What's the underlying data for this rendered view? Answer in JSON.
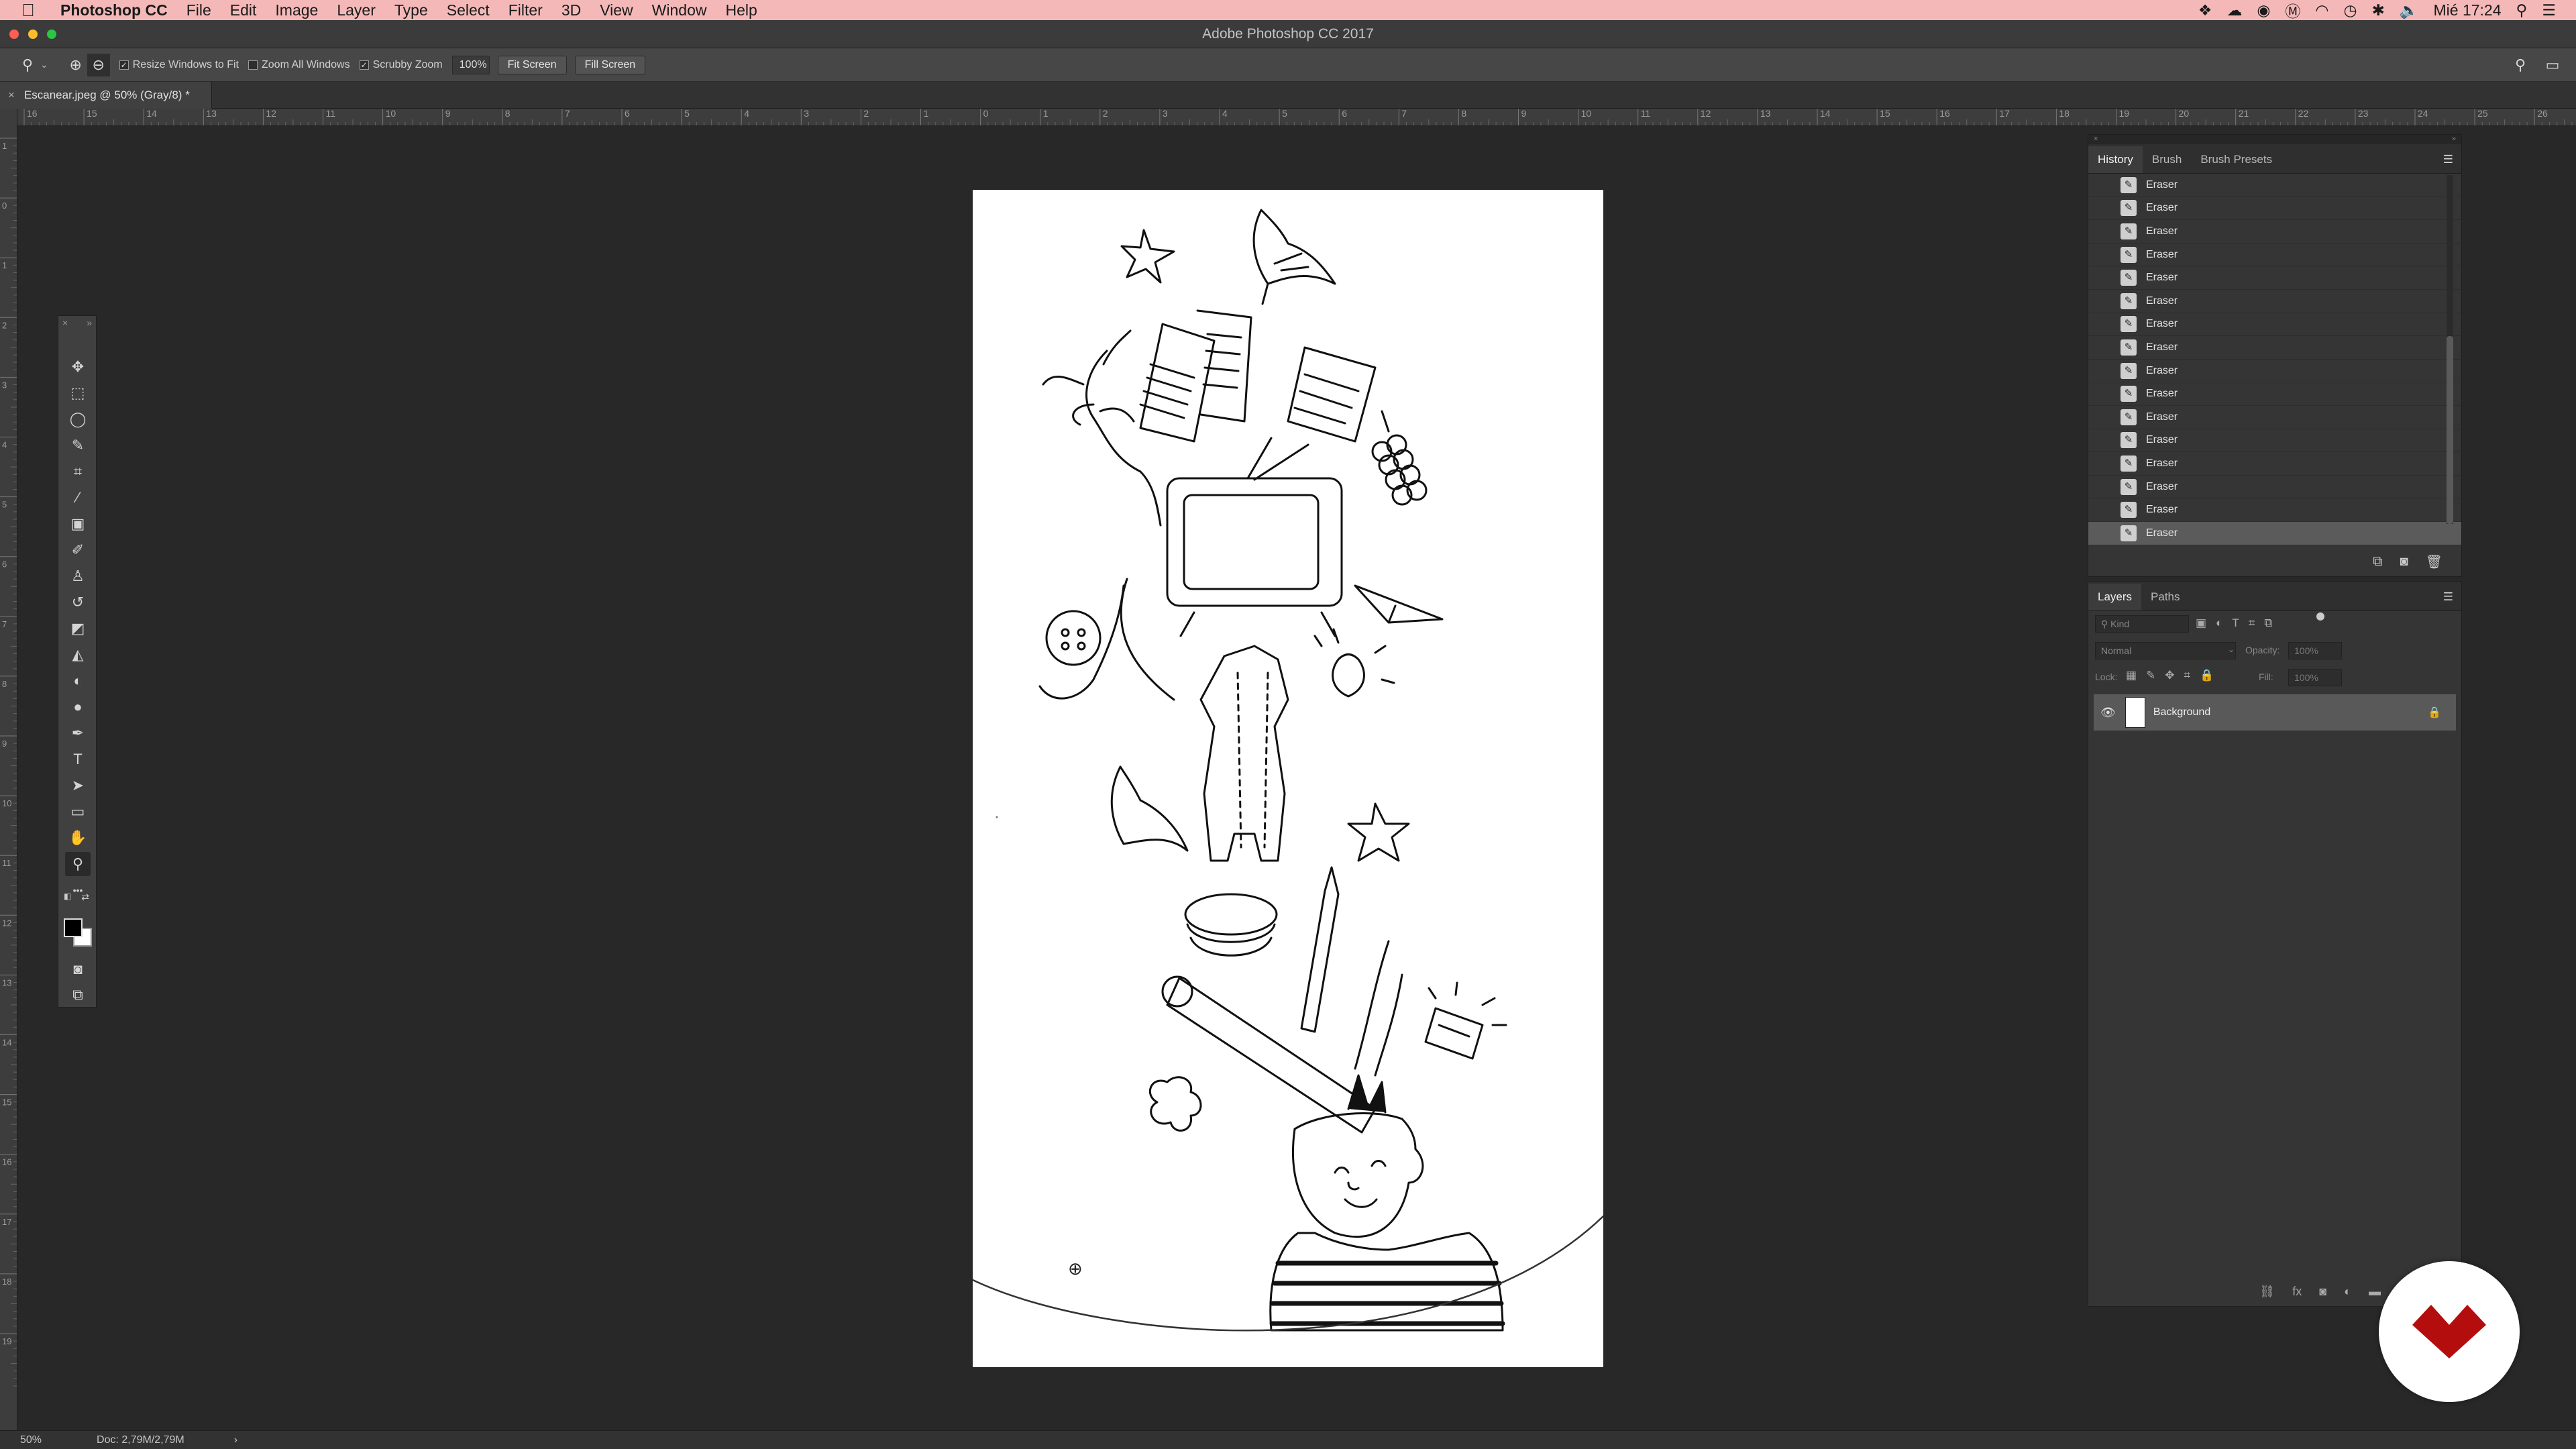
{
  "menubar": {
    "app_name": "Photoshop CC",
    "items": [
      "File",
      "Edit",
      "Image",
      "Layer",
      "Type",
      "Select",
      "Filter",
      "3D",
      "View",
      "Window",
      "Help"
    ],
    "clock": "Mié 17:24"
  },
  "window": {
    "title": "Adobe Photoshop CC 2017"
  },
  "options": {
    "resize_windows": "Resize Windows to Fit",
    "resize_windows_checked": true,
    "zoom_all_windows": "Zoom All Windows",
    "zoom_all_windows_checked": false,
    "scrubby_zoom": "Scrubby Zoom",
    "scrubby_zoom_checked": true,
    "zoom_value": "100%",
    "fit_screen": "Fit Screen",
    "fill_screen": "Fill Screen"
  },
  "document": {
    "tab_title": "Escanear.jpeg @ 50% (Gray/8) *",
    "close_glyph": "×"
  },
  "rulers": {
    "top_labels": [
      "16",
      "15",
      "14",
      "13",
      "12",
      "11",
      "10",
      "9",
      "8",
      "7",
      "6",
      "5",
      "4",
      "3",
      "2",
      "1",
      "0",
      "1",
      "2",
      "3",
      "4",
      "5",
      "6",
      "7",
      "8",
      "9",
      "10",
      "11",
      "12",
      "13",
      "14",
      "15",
      "16",
      "17",
      "18",
      "19",
      "20",
      "21",
      "22",
      "23",
      "24",
      "25",
      "26"
    ],
    "left_labels": [
      "1",
      "0",
      "1",
      "2",
      "3",
      "4",
      "5",
      "6",
      "7",
      "8",
      "9",
      "10",
      "11",
      "12",
      "13",
      "14",
      "15",
      "16",
      "17",
      "18",
      "19"
    ]
  },
  "tools": [
    {
      "name": "move-tool",
      "glyph": "✥"
    },
    {
      "name": "marquee-tool",
      "glyph": "⬚"
    },
    {
      "name": "lasso-tool",
      "glyph": "◯"
    },
    {
      "name": "quick-select-tool",
      "glyph": "✎"
    },
    {
      "name": "crop-tool",
      "glyph": "⌗"
    },
    {
      "name": "eyedropper-tool",
      "glyph": "⁄"
    },
    {
      "name": "frame-tool",
      "glyph": "▣"
    },
    {
      "name": "brush-tool",
      "glyph": "✐"
    },
    {
      "name": "stamp-tool",
      "glyph": "♙"
    },
    {
      "name": "history-brush-tool",
      "glyph": "↺"
    },
    {
      "name": "eraser-tool",
      "glyph": "◩"
    },
    {
      "name": "paint-bucket-tool",
      "glyph": "◭"
    },
    {
      "name": "blur-tool",
      "glyph": "◐"
    },
    {
      "name": "dodge-tool",
      "glyph": "●"
    },
    {
      "name": "pen-tool",
      "glyph": "✒"
    },
    {
      "name": "type-tool",
      "glyph": "T"
    },
    {
      "name": "path-select-tool",
      "glyph": "➤"
    },
    {
      "name": "rectangle-tool",
      "glyph": "▭"
    },
    {
      "name": "hand-tool",
      "glyph": "✋"
    },
    {
      "name": "zoom-tool",
      "glyph": "⚲"
    },
    {
      "name": "more-tools",
      "glyph": "•••"
    }
  ],
  "history": {
    "tabs": [
      "History",
      "Brush",
      "Brush Presets"
    ],
    "items": [
      "Eraser",
      "Eraser",
      "Eraser",
      "Eraser",
      "Eraser",
      "Eraser",
      "Eraser",
      "Eraser",
      "Eraser",
      "Eraser",
      "Eraser",
      "Eraser",
      "Eraser",
      "Eraser",
      "Eraser",
      "Eraser"
    ]
  },
  "layers": {
    "tabs": [
      "Layers",
      "Paths"
    ],
    "kind_placeholder": "Kind",
    "blend_mode": "Normal",
    "opacity_label": "Opacity:",
    "opacity_value": "100%",
    "lock_label": "Lock:",
    "fill_label": "Fill:",
    "fill_value": "100%",
    "layer_name": "Background"
  },
  "status": {
    "zoom": "50%",
    "doc_size": "Doc: 2,79M/2,79M"
  }
}
